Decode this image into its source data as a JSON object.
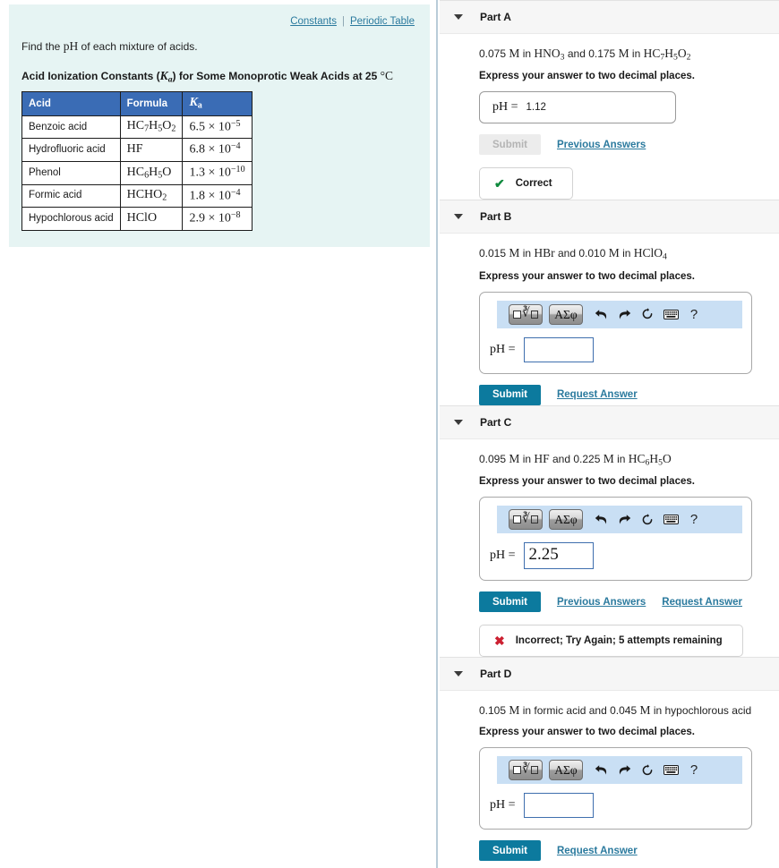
{
  "left": {
    "links": {
      "constants": "Constants",
      "separator": "|",
      "periodic_table": "Periodic Table"
    },
    "prompt_pre": "Find the ",
    "prompt_ph": "pH",
    "prompt_post": " of each mixture of acids.",
    "table_title_pre": "Acid Ionization Constants (",
    "table_title_k": "K",
    "table_title_sub": "a",
    "table_title_mid": ") for Some Monoprotic Weak Acids at 25 ",
    "table_title_deg": "°C",
    "table": {
      "headers": [
        "Acid",
        "Formula",
        "Ka"
      ],
      "rows": [
        {
          "acid": "Benzoic acid",
          "formula_parts": [
            "HC",
            "7",
            "H",
            "5",
            "O",
            "2"
          ],
          "ka_mant": "6.5",
          "ka_exp": "−5"
        },
        {
          "acid": "Hydrofluoric acid",
          "formula_plain": "HF",
          "ka_mant": "6.8",
          "ka_exp": "−4"
        },
        {
          "acid": "Phenol",
          "formula_parts": [
            "HC",
            "6",
            "H",
            "5",
            "O",
            ""
          ],
          "ka_mant": "1.3",
          "ka_exp": "−10"
        },
        {
          "acid": "Formic acid",
          "formula_parts": [
            "HCHO",
            "2",
            "",
            "",
            "",
            ""
          ],
          "ka_mant": "1.8",
          "ka_exp": "−4"
        },
        {
          "acid": "Hypochlorous acid",
          "formula_plain": "HClO",
          "ka_mant": "2.9",
          "ka_exp": "−8"
        }
      ]
    }
  },
  "toolbar_icons": {
    "math_template": "sqrt-template-icon",
    "greek_letters": "greek-symbols-icon",
    "undo": "undo-icon",
    "redo": "redo-icon",
    "reset": "reset-icon",
    "keyboard": "keyboard-icon",
    "help": "?"
  },
  "common": {
    "instruction": "Express your answer to two decimal places.",
    "ph_label": "pH =",
    "submit": "Submit",
    "previous_answers": "Previous Answers",
    "request_answer": "Request Answer"
  },
  "parts": [
    {
      "id": "a",
      "title": "Part A",
      "question_segments": [
        {
          "t": "0.075 ",
          "s": false
        },
        {
          "t": "M",
          "s": true
        },
        {
          "t": " in ",
          "s": false
        },
        {
          "t": "HNO",
          "s": true,
          "sub": "3"
        },
        {
          "t": " and 0.175 ",
          "s": false
        },
        {
          "t": "M",
          "s": true
        },
        {
          "t": " in ",
          "s": false
        },
        {
          "t": "HC",
          "s": true,
          "sub": "7"
        },
        {
          "t": "H",
          "s": true,
          "sub": "5"
        },
        {
          "t": "O",
          "s": true,
          "sub": "2"
        }
      ],
      "answer_value": "1.12",
      "widget": "filled",
      "submit_disabled": true,
      "show_previous": true,
      "show_request": false,
      "feedback": {
        "type": "correct",
        "icon": "✔",
        "text": "Correct"
      }
    },
    {
      "id": "b",
      "title": "Part B",
      "question_segments": [
        {
          "t": "0.015 ",
          "s": false
        },
        {
          "t": "M",
          "s": true
        },
        {
          "t": " in ",
          "s": false
        },
        {
          "t": "HBr",
          "s": true
        },
        {
          "t": " and 0.010 ",
          "s": false
        },
        {
          "t": "M",
          "s": true
        },
        {
          "t": " in ",
          "s": false
        },
        {
          "t": "HClO",
          "s": true,
          "sub": "4"
        }
      ],
      "answer_value": "",
      "widget": "math",
      "submit_disabled": false,
      "show_previous": false,
      "show_request": true,
      "feedback": null
    },
    {
      "id": "c",
      "title": "Part C",
      "question_segments": [
        {
          "t": "0.095 ",
          "s": false
        },
        {
          "t": "M",
          "s": true
        },
        {
          "t": " in ",
          "s": false
        },
        {
          "t": "HF",
          "s": true
        },
        {
          "t": " and 0.225 ",
          "s": false
        },
        {
          "t": "M",
          "s": true
        },
        {
          "t": " in ",
          "s": false
        },
        {
          "t": "HC",
          "s": true,
          "sub": "6"
        },
        {
          "t": "H",
          "s": true,
          "sub": "5"
        },
        {
          "t": "O",
          "s": true
        }
      ],
      "answer_value": "2.25",
      "widget": "math",
      "submit_disabled": false,
      "show_previous": true,
      "show_request": true,
      "feedback": {
        "type": "incorrect",
        "icon": "✖",
        "text": "Incorrect; Try Again; 5 attempts remaining"
      }
    },
    {
      "id": "d",
      "title": "Part D",
      "question_segments": [
        {
          "t": "0.105 ",
          "s": false
        },
        {
          "t": "M",
          "s": true
        },
        {
          "t": " in formic acid and 0.045 ",
          "s": false
        },
        {
          "t": "M",
          "s": true
        },
        {
          "t": " in hypochlorous acid",
          "s": false
        }
      ],
      "answer_value": "",
      "widget": "math",
      "submit_disabled": false,
      "show_previous": false,
      "show_request": true,
      "feedback": null
    }
  ],
  "colors": {
    "panel_bg": "#e6f4f3",
    "table_header": "#3a6cb5",
    "link": "#2b7a9e",
    "submit": "#0c7a9e",
    "toolbar_bg": "#c9dff4",
    "correct": "#108a3e",
    "incorrect": "#cc2031"
  }
}
